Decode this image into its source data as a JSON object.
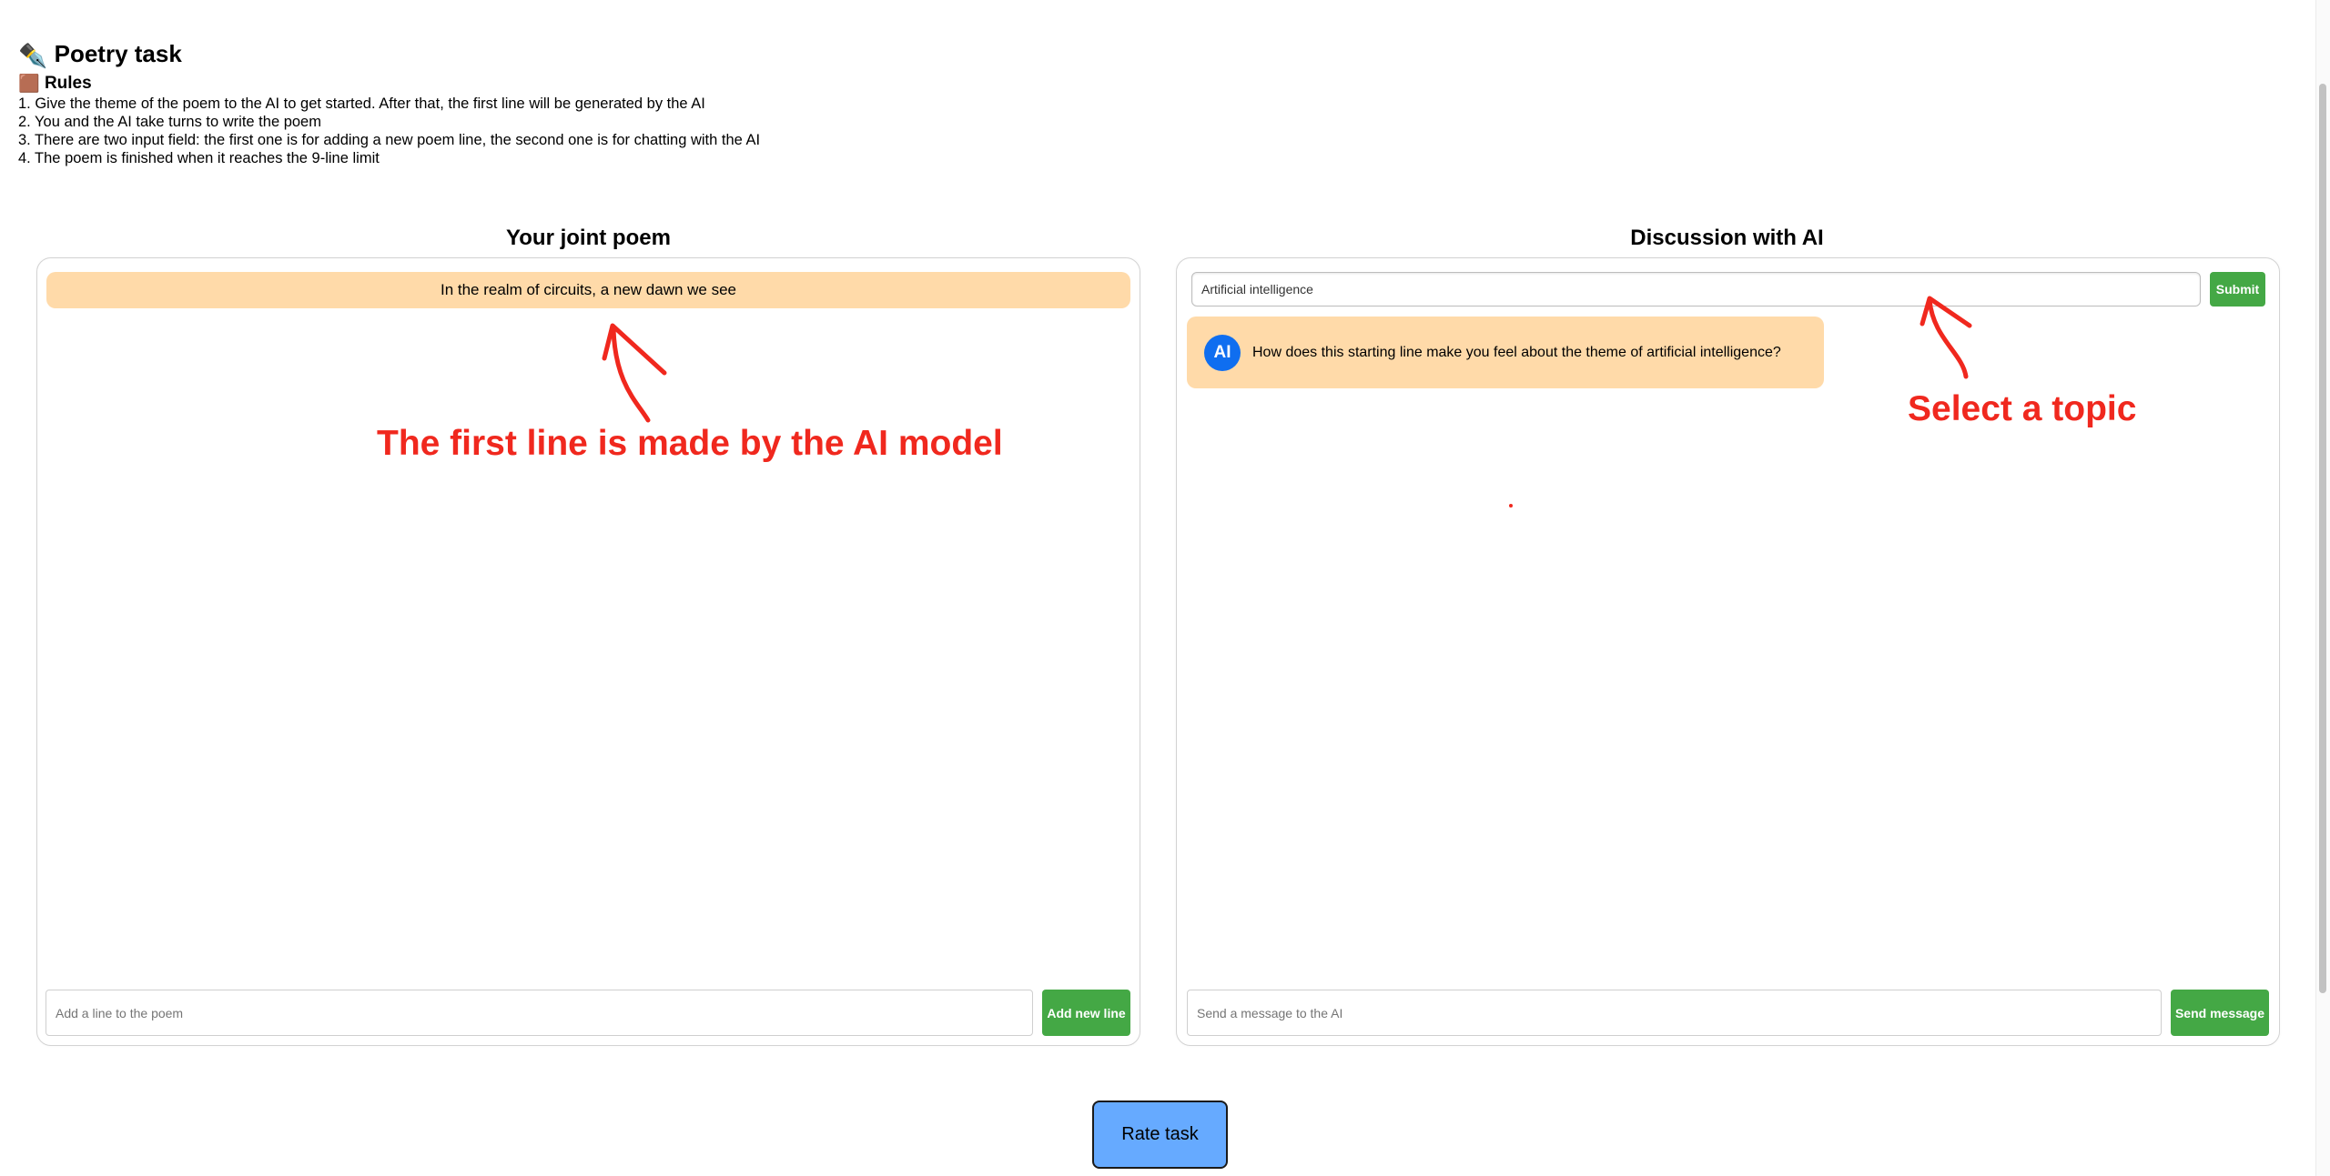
{
  "header": {
    "title_icon": "✒️",
    "title": "Poetry task",
    "rules_icon": "🟫",
    "rules_title": "Rules",
    "rules": [
      "1. Give the theme of the poem to the AI to get started. After that, the first line will be generated by the AI",
      "2. You and the AI take turns to write the poem",
      "3. There are two input field: the first one is for adding a new poem line, the second one is for chatting with the AI",
      "4. The poem is finished when it reaches the 9-line limit"
    ]
  },
  "poem": {
    "title": "Your joint poem",
    "lines": [
      "In the realm of circuits, a new dawn we see"
    ],
    "input_placeholder": "Add a line to the poem",
    "add_button": "Add new line"
  },
  "chat": {
    "title": "Discussion with AI",
    "topic_value": "Artificial intelligence",
    "submit_button": "Submit",
    "messages": [
      {
        "avatar": "AI",
        "text": "How does this starting line make you feel about the theme of artificial intelligence?"
      }
    ],
    "input_placeholder": "Send a message to the AI",
    "send_button": "Send message"
  },
  "rate_button": "Rate task",
  "annotations": {
    "first_line": "The first line is made by the AI model",
    "topic": "Select a topic",
    "color": "#f0281e"
  },
  "colors": {
    "highlight": "#ffdaa9",
    "green_button": "#44a845",
    "rate_button": "#66aaff",
    "ai_avatar": "#0f6ef0"
  }
}
